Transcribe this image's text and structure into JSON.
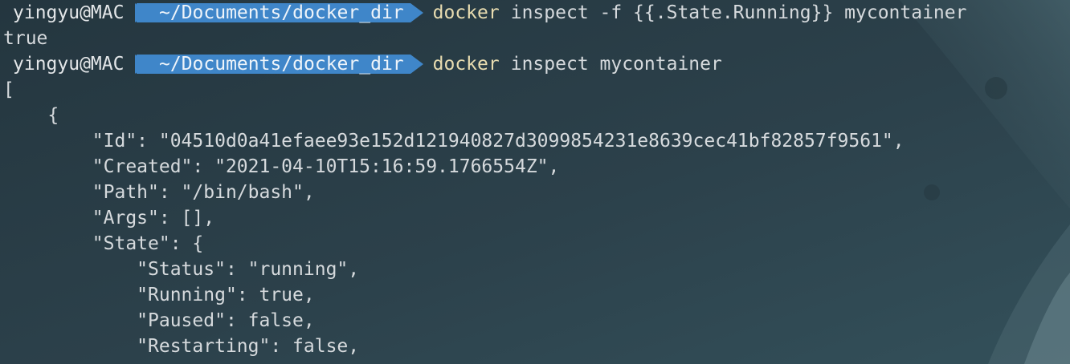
{
  "prompt": {
    "user_host": "yingyu@MAC",
    "path": "~/Documents/docker_dir"
  },
  "commands": [
    {
      "program": "docker",
      "args": "inspect -f {{.State.Running}} mycontainer"
    },
    {
      "program": "docker",
      "args": "inspect mycontainer"
    }
  ],
  "output": {
    "running_result": "true",
    "json_lines": [
      "[",
      "    {",
      "        \"Id\": \"04510d0a41efaee93e152d121940827d3099854231e8639cec41bf82857f9561\",",
      "        \"Created\": \"2021-04-10T15:16:59.1766554Z\",",
      "        \"Path\": \"/bin/bash\",",
      "        \"Args\": [],",
      "        \"State\": {",
      "            \"Status\": \"running\",",
      "            \"Running\": true,",
      "            \"Paused\": false,",
      "            \"Restarting\": false,"
    ]
  },
  "colors": {
    "background": "#2a3d47",
    "path_segment": "#3f86c9",
    "command": "#e8dcb0",
    "text": "#d6dadd"
  }
}
